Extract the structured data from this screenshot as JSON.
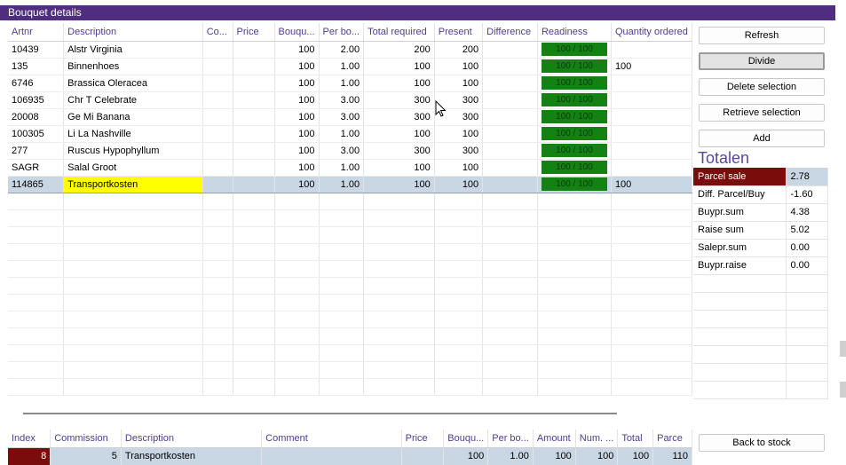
{
  "panel_title": "Bouquet details",
  "main_grid": {
    "columns": [
      "Artnr",
      "Description",
      "Co...",
      "Price",
      "Bouqu...",
      "Per bo...",
      "Total required",
      "Present",
      "Difference",
      "Readiness",
      "Quantity ordered"
    ],
    "rows": [
      {
        "artnr": "10439",
        "description": "Alstr Virginia",
        "co": "",
        "price": "",
        "bouquets": "100",
        "per_bouquet": "2.00",
        "total_required": "200",
        "present": "200",
        "difference": "",
        "readiness": "100 / 100",
        "quantity_ordered": ""
      },
      {
        "artnr": "135",
        "description": "Binnenhoes",
        "co": "",
        "price": "",
        "bouquets": "100",
        "per_bouquet": "1.00",
        "total_required": "100",
        "present": "100",
        "difference": "",
        "readiness": "100 / 100",
        "quantity_ordered": "100"
      },
      {
        "artnr": "6746",
        "description": "Brassica Oleracea",
        "co": "",
        "price": "",
        "bouquets": "100",
        "per_bouquet": "1.00",
        "total_required": "100",
        "present": "100",
        "difference": "",
        "readiness": "100 / 100",
        "quantity_ordered": ""
      },
      {
        "artnr": "106935",
        "description": "Chr T Celebrate",
        "co": "",
        "price": "",
        "bouquets": "100",
        "per_bouquet": "3.00",
        "total_required": "300",
        "present": "300",
        "difference": "",
        "readiness": "100 / 100",
        "quantity_ordered": ""
      },
      {
        "artnr": "20008",
        "description": "Ge Mi Banana",
        "co": "",
        "price": "",
        "bouquets": "100",
        "per_bouquet": "3.00",
        "total_required": "300",
        "present": "300",
        "difference": "",
        "readiness": "100 / 100",
        "quantity_ordered": ""
      },
      {
        "artnr": "100305",
        "description": "Li La Nashville",
        "co": "",
        "price": "",
        "bouquets": "100",
        "per_bouquet": "1.00",
        "total_required": "100",
        "present": "100",
        "difference": "",
        "readiness": "100 / 100",
        "quantity_ordered": ""
      },
      {
        "artnr": "277",
        "description": "Ruscus Hypophyllum",
        "co": "",
        "price": "",
        "bouquets": "100",
        "per_bouquet": "3.00",
        "total_required": "300",
        "present": "300",
        "difference": "",
        "readiness": "100 / 100",
        "quantity_ordered": ""
      },
      {
        "artnr": "SAGR",
        "description": "Salal Groot",
        "co": "",
        "price": "",
        "bouquets": "100",
        "per_bouquet": "1.00",
        "total_required": "100",
        "present": "100",
        "difference": "",
        "readiness": "100 / 100",
        "quantity_ordered": ""
      },
      {
        "artnr": "114865",
        "description": "Transportkosten",
        "co": "",
        "price": "",
        "bouquets": "100",
        "per_bouquet": "1.00",
        "total_required": "100",
        "present": "100",
        "difference": "",
        "readiness": "100 / 100",
        "quantity_ordered": "100",
        "selected": true
      }
    ]
  },
  "buttons": {
    "refresh": "Refresh",
    "divide": "Divide",
    "delete_selection": "Delete selection",
    "retrieve_selection": "Retrieve selection",
    "add": "Add",
    "back_to_stock": "Back to stock"
  },
  "totals": {
    "title": "Totalen",
    "rows": [
      {
        "label": "Parcel sale",
        "value": "2.78"
      },
      {
        "label": "Diff. Parcel/Buy",
        "value": "-1.60"
      },
      {
        "label": "Buypr.sum",
        "value": "4.38"
      },
      {
        "label": "Raise sum",
        "value": "5.02"
      },
      {
        "label": "Salepr.sum",
        "value": "0.00"
      },
      {
        "label": "Buypr.raise",
        "value": "0.00"
      }
    ]
  },
  "bottom_grid": {
    "columns": [
      "Index",
      "Commission",
      "Description",
      "Comment",
      "Price",
      "Bouqu...",
      "Per bo...",
      "Amount",
      "Num. ...",
      "Total",
      "Parce"
    ],
    "rows": [
      {
        "index": "8",
        "commission": "5",
        "description": "Transportkosten",
        "comment": "",
        "price": "",
        "bouquets": "100",
        "per_bouquet": "1.00",
        "amount": "100",
        "num": "100",
        "total": "100",
        "parcel": "110"
      }
    ]
  },
  "colors": {
    "title_bar": "#4f2d7f",
    "readiness_ok": "#138213",
    "highlight_yellow": "#ffff00",
    "highlight_red": "#7a0c0c",
    "selection": "#c9d6e3"
  }
}
